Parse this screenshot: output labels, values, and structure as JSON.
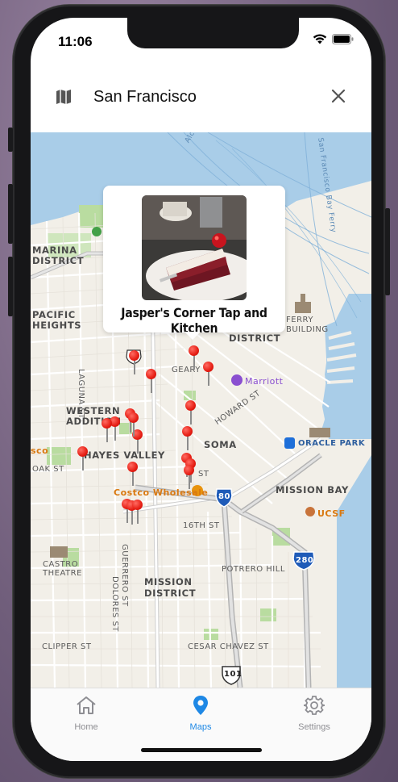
{
  "status": {
    "time": "11:06"
  },
  "header": {
    "title": "San Francisco"
  },
  "callout": {
    "name": "Jasper's Corner Tap and Kitchen"
  },
  "map_labels": {
    "marina": "MARINA",
    "district": "DISTRICT",
    "pacific": "PACIFIC",
    "heights": "HEIGHTS",
    "laguna": "LAGUNA ST",
    "western": "WESTERN",
    "addition": "ADDITION",
    "hayes": "HAYES VALLEY",
    "oak": "OAK ST",
    "geary": "GEARY",
    "howard": "HOWARD ST",
    "soma": "SOMA",
    "marriott": "Marriott",
    "oracle": "ORACLE PARK",
    "mission_bay": "MISSION BAY",
    "ucsf": "UCSF",
    "costco": "Costco Wholesale",
    "sixteenth": "16TH ST",
    "castro": "CASTRO",
    "theatre": "THEATRE",
    "guerrero": "GUERRERO ST",
    "dolores": "DOLORES ST",
    "mission": "MISSION",
    "mission_district": "DISTRICT",
    "potrero": "POTRERO HILL",
    "clipper": "CLIPPER ST",
    "cesar": "CESAR CHAVEZ ST",
    "ferry": "FERRY",
    "building": "BUILDING",
    "district2": "DISTRICT",
    "alcatraz": "Alcatraz Cruises",
    "sfbay": "San Francisco Bay Ferry",
    "shield80": "80",
    "shield280": "280",
    "shield101": "101",
    "sco": "sco",
    "st": "ST"
  },
  "tabs": [
    {
      "label": "Home",
      "icon": "home-icon",
      "active": false
    },
    {
      "label": "Maps",
      "icon": "location-pin-icon",
      "active": true
    },
    {
      "label": "Settings",
      "icon": "gear-icon",
      "active": false
    }
  ],
  "colors": {
    "accent": "#1e88e5",
    "pin": "#e61e14",
    "water": "#a9cde8",
    "park": "#b9dca0"
  }
}
